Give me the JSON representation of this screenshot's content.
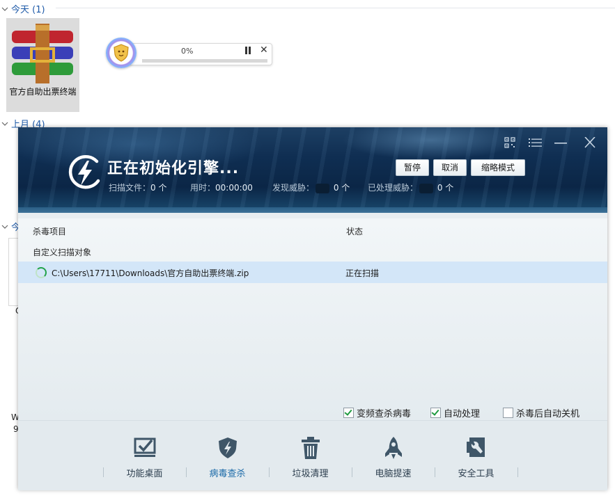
{
  "explorer": {
    "groups": [
      {
        "label": "今天 (1)"
      },
      {
        "label": "上月 (4)"
      },
      {
        "label": "今"
      }
    ],
    "file": {
      "name": "官方自助出票终端",
      "icon": "winrar-archive-icon"
    },
    "fragments": [
      "C",
      "W",
      "9"
    ]
  },
  "mini_progress": {
    "percent_text": "0%",
    "progress": 0.0,
    "pause_icon": "pause-icon",
    "close_label": "✕"
  },
  "scanner": {
    "title": "正在初始化引擎...",
    "stats": {
      "files_label": "扫描文件：",
      "files_value": "0 个",
      "time_label": "用时：",
      "time_value": "00:00:00",
      "threats_label": "发现威胁：",
      "threats_value": "0 个",
      "handled_label": "已处理威胁：",
      "handled_value": "0 个"
    },
    "buttons": {
      "pause": "暂停",
      "cancel": "取消",
      "compact": "缩略模式"
    },
    "window_icons": [
      "qr-code-icon",
      "menu-icon",
      "minimize-icon",
      "close-icon"
    ],
    "table": {
      "col_item": "杀毒项目",
      "col_status": "状态",
      "section": "自定义扫描对象",
      "rows": [
        {
          "path": "C:\\Users\\17711\\Downloads\\官方自助出票终端.zip",
          "status": "正在扫描"
        }
      ]
    },
    "options": [
      {
        "label": "变频查杀病毒",
        "checked": true
      },
      {
        "label": "自动处理",
        "checked": true
      },
      {
        "label": "杀毒后自动关机",
        "checked": false
      }
    ],
    "tools": [
      {
        "label": "功能桌面",
        "icon": "desktop-check-icon",
        "active": false
      },
      {
        "label": "病毒查杀",
        "icon": "shield-bolt-icon",
        "active": true
      },
      {
        "label": "垃圾清理",
        "icon": "trash-icon",
        "active": false
      },
      {
        "label": "电脑提速",
        "icon": "rocket-icon",
        "active": false
      },
      {
        "label": "安全工具",
        "icon": "toolbox-icon",
        "active": false
      }
    ],
    "colors": {
      "header": "#0f2e52",
      "accent": "#1b6aa8",
      "row_highlight": "#d3e6f8",
      "check": "#1e9a3f"
    }
  }
}
